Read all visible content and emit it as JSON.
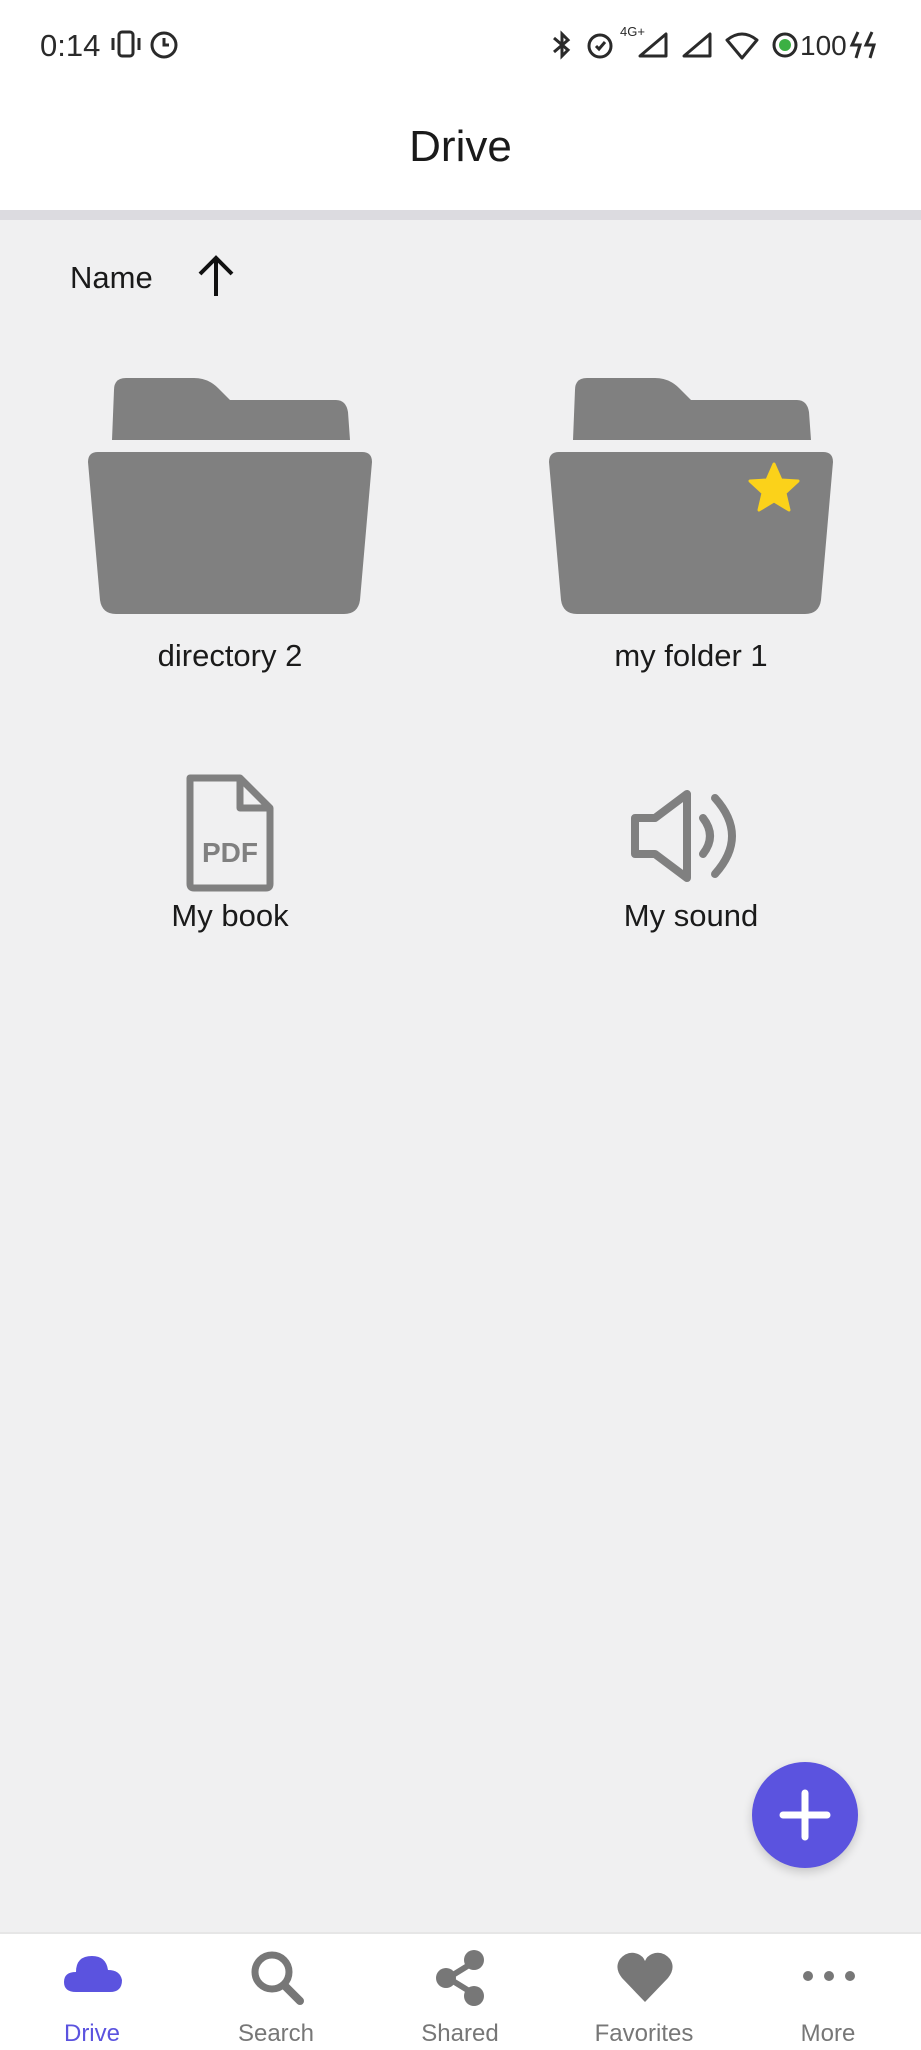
{
  "status_bar": {
    "time": "0:14",
    "battery": "100",
    "network": "4G+"
  },
  "app_bar": {
    "title": "Drive"
  },
  "sort": {
    "label": "Name",
    "direction": "ascending",
    "icon": "arrow-up-icon"
  },
  "items": [
    {
      "name": "directory 2",
      "type": "folder",
      "favorite": false
    },
    {
      "name": "my folder 1",
      "type": "folder",
      "favorite": true
    },
    {
      "name": "My book",
      "type": "pdf",
      "icon_text": "PDF"
    },
    {
      "name": "My sound",
      "type": "audio"
    }
  ],
  "fab": {
    "icon": "plus-icon"
  },
  "bottom_nav": {
    "items": [
      {
        "label": "Drive",
        "icon": "cloud-icon",
        "active": true
      },
      {
        "label": "Search",
        "icon": "search-icon",
        "active": false
      },
      {
        "label": "Shared",
        "icon": "share-icon",
        "active": false
      },
      {
        "label": "Favorites",
        "icon": "heart-icon",
        "active": false
      },
      {
        "label": "More",
        "icon": "more-icon",
        "active": false
      }
    ]
  },
  "colors": {
    "accent": "#5b53df",
    "icon_gray": "#808080",
    "star": "#fbd21a",
    "background": "#f0f0f1"
  }
}
